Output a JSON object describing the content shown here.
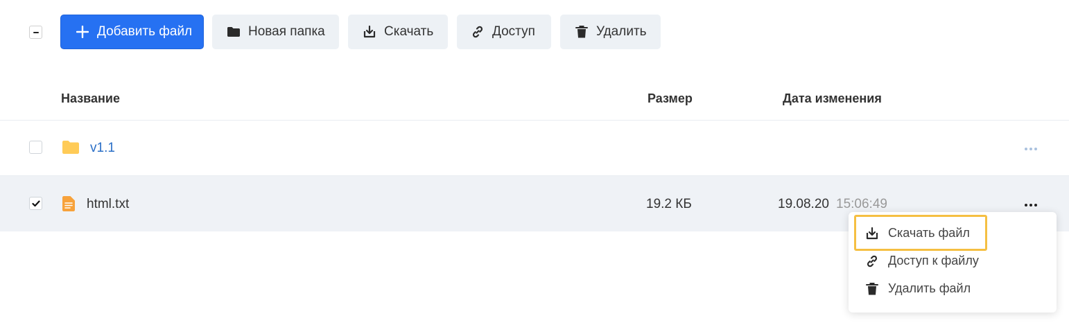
{
  "toolbar": {
    "add_file": "Добавить файл",
    "new_folder": "Новая папка",
    "download": "Скачать",
    "access": "Доступ",
    "delete": "Удалить"
  },
  "table": {
    "columns": [
      "Название",
      "Размер",
      "Дата изменения"
    ],
    "rows": [
      {
        "name": "v1.1",
        "type": "folder",
        "checked": false,
        "size": "",
        "date": "",
        "time": ""
      },
      {
        "name": "html.txt",
        "type": "file",
        "checked": true,
        "size": "19.2 КБ",
        "date": "19.08.20",
        "time": "15:06:49"
      }
    ]
  },
  "context_menu": {
    "items": [
      "Скачать файл",
      "Доступ к файлу",
      "Удалить файл"
    ],
    "highlighted": "Скачать файл"
  },
  "icons": {
    "add": "plus-icon",
    "folder": "folder-icon",
    "download": "download-icon",
    "link": "link-icon",
    "trash": "trash-icon",
    "file": "document-icon",
    "more": "more-horizontal-icon"
  },
  "colors": {
    "primary": "#2671f2",
    "folder_link": "#2a6fc7",
    "folder_icon": "#ffcb57",
    "file_icon": "#f7a23b",
    "highlight": "#f5bf42",
    "selected_row": "#eff2f6"
  }
}
